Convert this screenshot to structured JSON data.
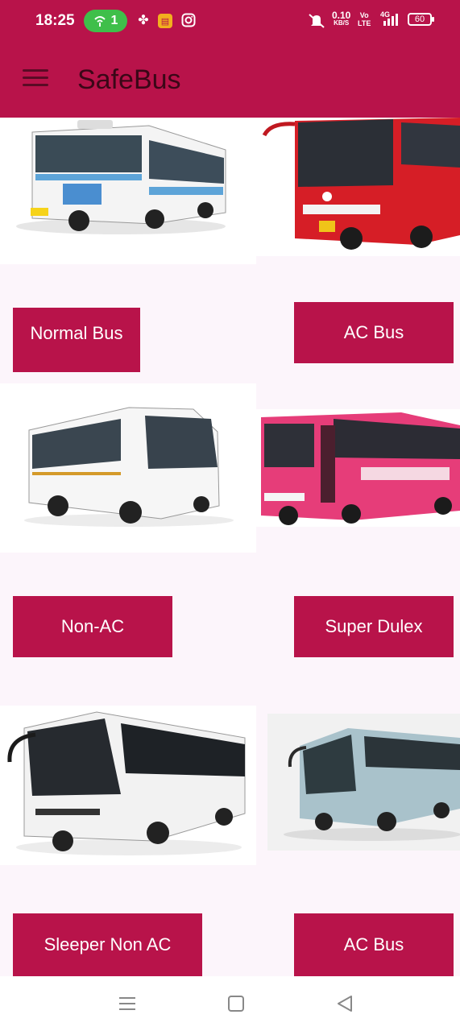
{
  "status_bar": {
    "time": "18:25",
    "hotspot_count": "1",
    "net_speed_value": "0.10",
    "net_speed_unit": "KB/S",
    "volte_top": "Vo",
    "volte_bottom": "LTE",
    "signal": "4G",
    "battery": "60"
  },
  "app_bar": {
    "title": "SafeBus"
  },
  "bus_types": [
    {
      "label": "Normal Bus",
      "image": "white-city-bus-image"
    },
    {
      "label": "AC Bus",
      "image": "red-ac-bus-image"
    },
    {
      "label": "Non-AC",
      "image": "white-coach-bus-image"
    },
    {
      "label": "Super Dulex",
      "image": "pink-tsrtc-bus-image"
    },
    {
      "label": "Sleeper Non AC",
      "image": "white-scania-bus-image"
    },
    {
      "label": "AC Bus",
      "image": "silver-volvo-bus-image"
    }
  ],
  "colors": {
    "primary": "#b8134a",
    "background": "#fcf5fb"
  },
  "nav_bar": {
    "icons": [
      "menu-lines-icon",
      "home-square-icon",
      "back-triangle-icon"
    ]
  }
}
